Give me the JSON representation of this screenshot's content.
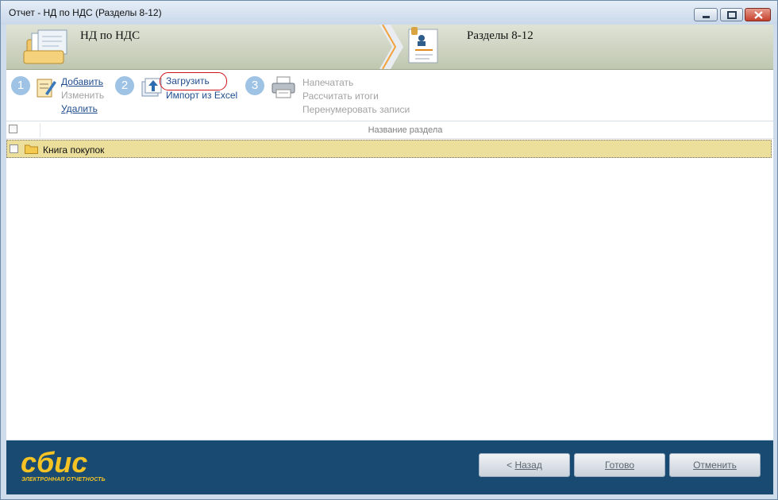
{
  "window": {
    "title": "Отчет - НД по НДС (Разделы 8-12)"
  },
  "header": {
    "left_title": "НД по НДС",
    "right_title": "Разделы 8-12"
  },
  "toolbar": {
    "step1": {
      "number": "1",
      "add": "Добавить",
      "edit": "Изменить",
      "delete": "Удалить"
    },
    "step2": {
      "number": "2",
      "load": "Загрузить",
      "import_excel": "Импорт из Excel"
    },
    "step3": {
      "number": "3",
      "print": "Напечатать",
      "calc_totals": "Рассчитать итоги",
      "renumber": "Перенумеровать записи"
    }
  },
  "grid": {
    "column_header": "Название раздела",
    "rows": [
      {
        "label": "Книга покупок"
      }
    ]
  },
  "footer": {
    "logo_text": "сбис",
    "logo_subtitle": "ЭЛЕКТРОННАЯ ОТЧЕТНОСТЬ",
    "back_prefix": "< ",
    "back_label": "Назад",
    "done_label": "Готово",
    "cancel_label": "Отменить"
  },
  "colors": {
    "accent_blue": "#194a72",
    "selected_row": "#ecdf9c",
    "logo_yellow": "#f5c323",
    "highlight_oval": "#d0121b"
  }
}
